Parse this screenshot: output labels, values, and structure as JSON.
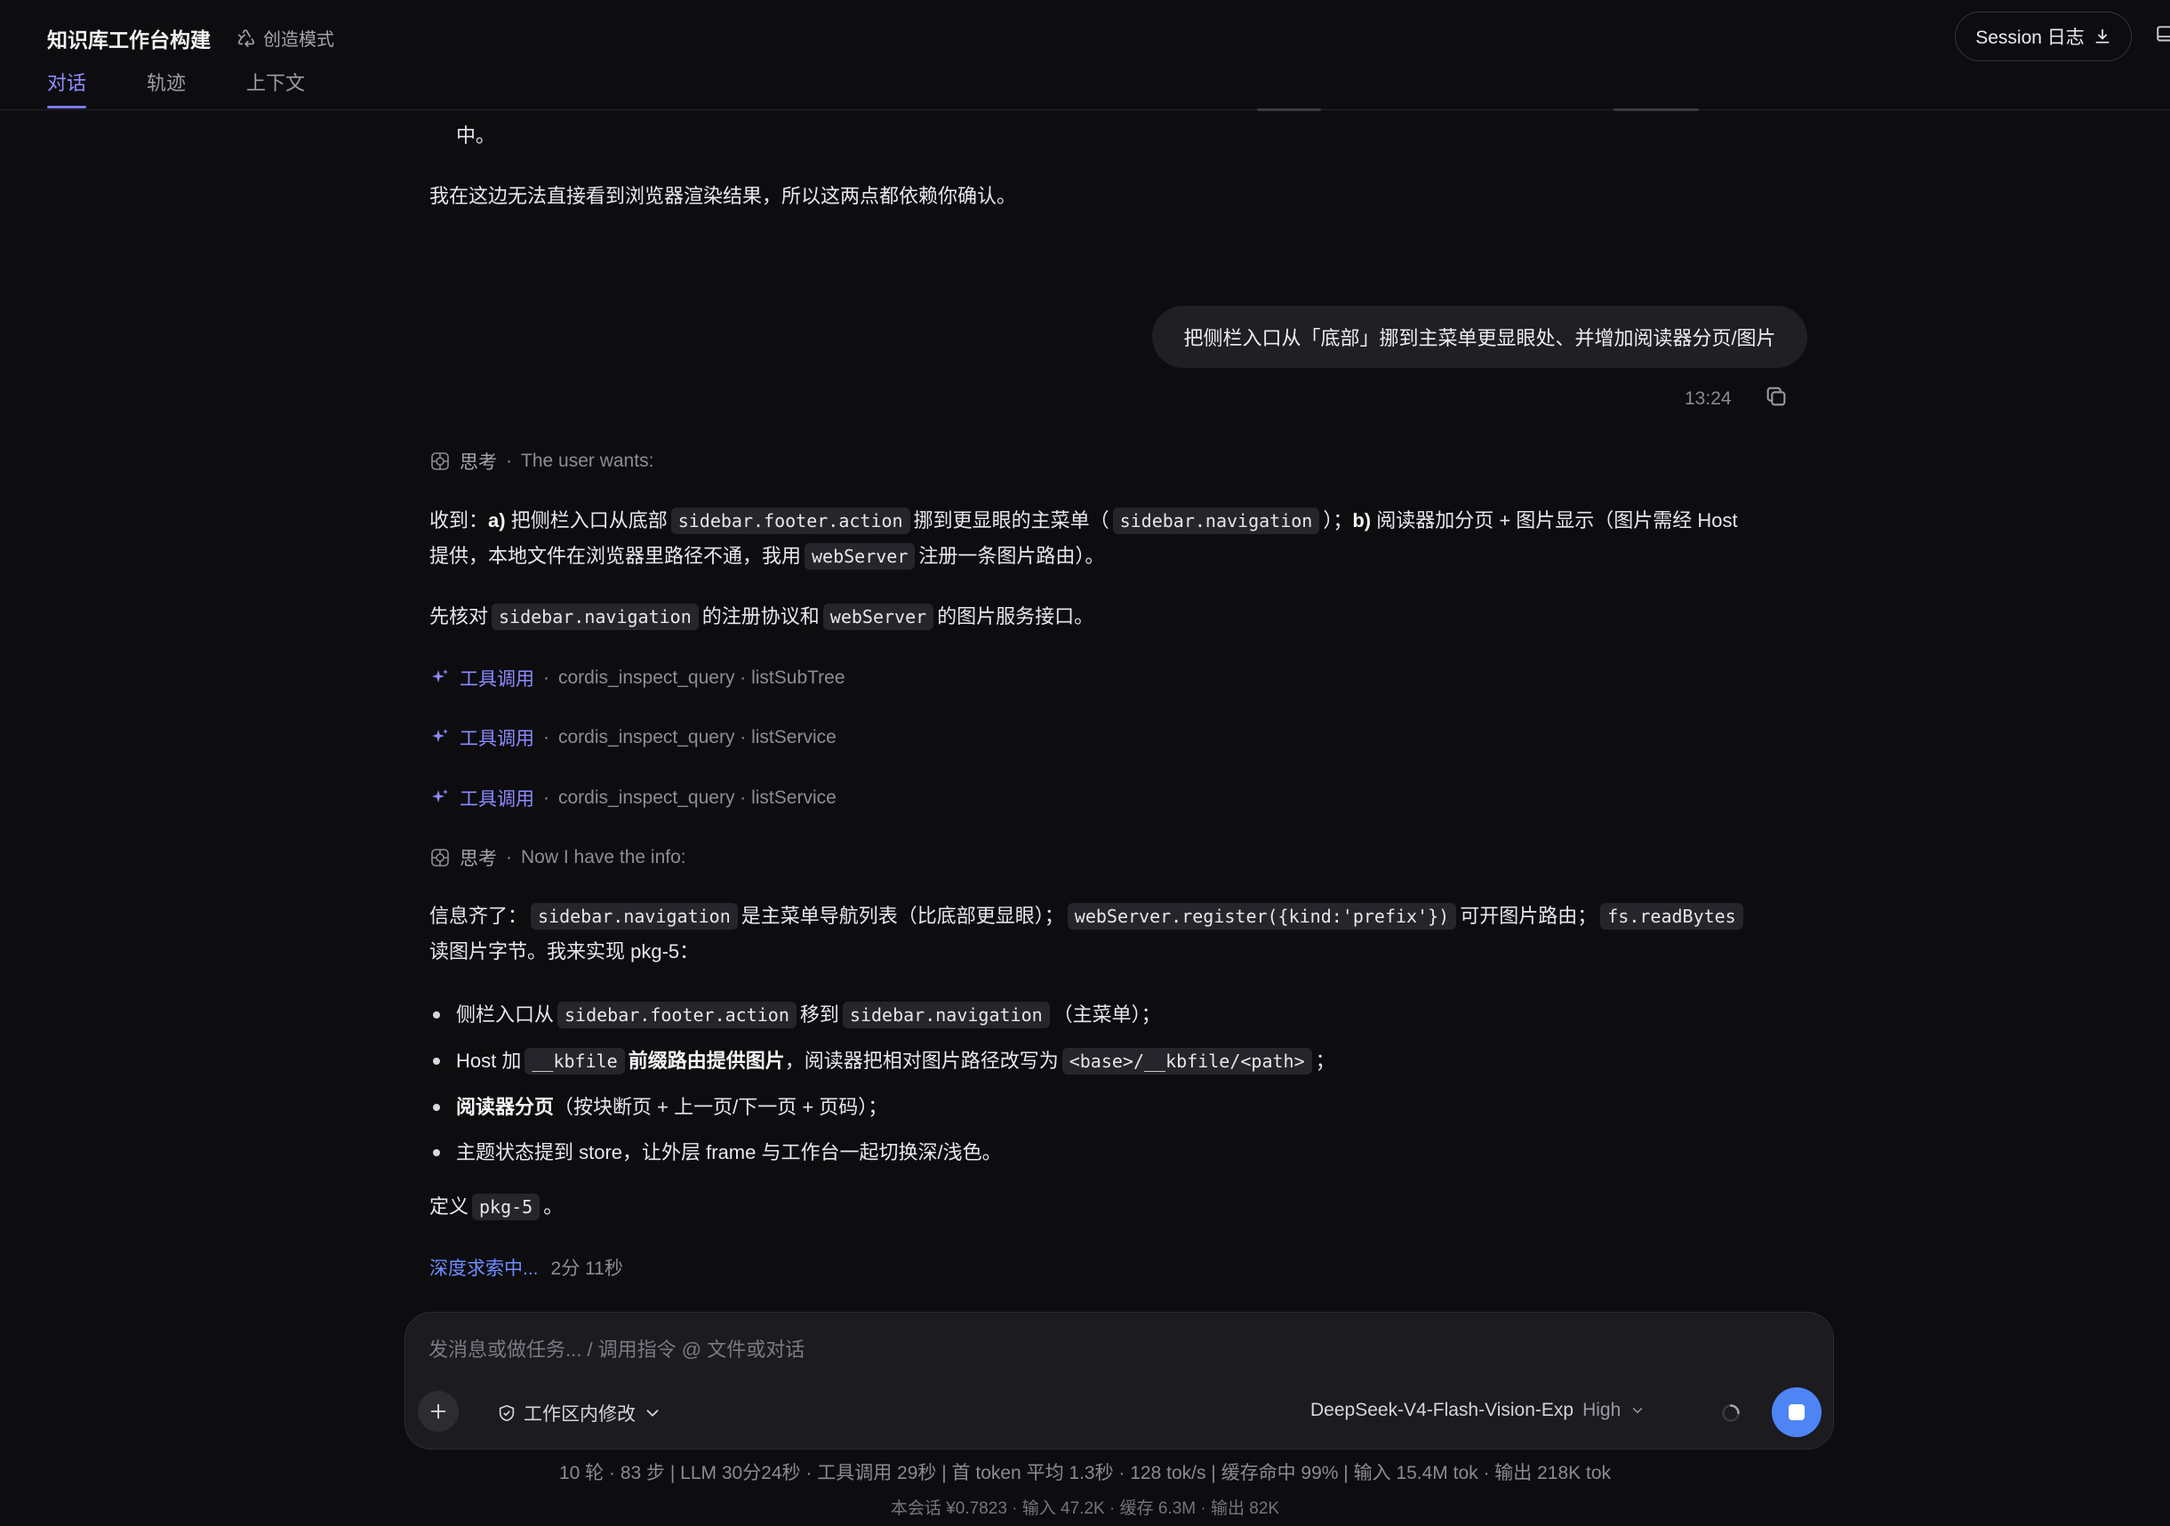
{
  "header": {
    "title": "知识库工作台构建",
    "mode": "创造模式",
    "tabs": [
      {
        "label": "对话",
        "active": true
      },
      {
        "label": "轨迹",
        "active": false
      },
      {
        "label": "上下文",
        "active": false
      }
    ],
    "session_button": "Session 日志"
  },
  "conversation": {
    "prev_tail": "中。",
    "prev_line": "我在这边无法直接看到浏览器渲染结果，所以这两点都依赖你确认。",
    "user_message": "把侧栏入口从「底部」挪到主菜单更显眼处、并增加阅读器分页/图片",
    "user_time": "13:24",
    "think1": {
      "label": "思考",
      "text": "The user wants:"
    },
    "reply1": {
      "t1": "收到：",
      "a": "a)",
      "t2": " 把侧栏入口从底部",
      "c1": "sidebar.footer.action",
      "t3": "挪到更显眼的主菜单（",
      "c2": "sidebar.navigation",
      "t4": "）；",
      "b": "b)",
      "t5": " 阅读器加分页 + 图片显示（图片需经 Host",
      "t6": "提供，本地文件在浏览器里路径不通，我用",
      "c3": "webServer",
      "t7": "注册一条图片路由）。"
    },
    "reply2": {
      "t1": "先核对",
      "c1": "sidebar.navigation",
      "t2": "的注册协议和",
      "c2": "webServer",
      "t3": "的图片服务接口。"
    },
    "tool_calls": [
      {
        "label": "工具调用",
        "detail": "cordis_inspect_query · listSubTree"
      },
      {
        "label": "工具调用",
        "detail": "cordis_inspect_query · listService"
      },
      {
        "label": "工具调用",
        "detail": "cordis_inspect_query · listService"
      }
    ],
    "think2": {
      "label": "思考",
      "text": "Now I have the info:"
    },
    "reply3": {
      "t1": "信息齐了：",
      "c1": "sidebar.navigation",
      "t2": "是主菜单导航列表（比底部更显眼）；",
      "c2": "webServer.register({kind:'prefix'})",
      "t3": "可开图片路由；",
      "c3": "fs.readBytes",
      "t4": "读图片字节。我来实现 pkg-5："
    },
    "bullets": {
      "b1": {
        "t1": "侧栏入口从",
        "c1": "sidebar.footer.action",
        "t2": "移到",
        "c2": "sidebar.navigation",
        "t3": "（主菜单）；"
      },
      "b2": {
        "t1": "Host 加",
        "c1": "__kbfile",
        "t2": "前缀路由提供图片",
        "t3": "，阅读器把相对图片路径改写为",
        "c2": "<base>/__kbfile/<path>",
        "t4": "；"
      },
      "b3": {
        "t1": "阅读器分页",
        "t2": "（按块断页 + 上一页/下一页 + 页码）；"
      },
      "b4": {
        "t1": "主题状态提到 store，让外层 frame 与工作台一起切换深/浅色。"
      }
    },
    "define": {
      "t1": "定义",
      "c1": "pkg-5",
      "t2": "。"
    },
    "searching": {
      "label": "深度求索中...",
      "elapsed": "2分 11秒"
    }
  },
  "composer": {
    "placeholder": "发消息或做任务... / 调用指令 @ 文件或对话",
    "value": "",
    "scope": "工作区内修改",
    "model": "DeepSeek-V4-Flash-Vision-Exp",
    "level": "High"
  },
  "stats": {
    "line1": "10 轮 · 83 步  |  LLM 30分24秒 · 工具调用 29秒  |  首 token 平均 1.3秒 · 128 tok/s  |  缓存命中 99%  |  输入 15.4M tok · 输出 218K tok",
    "line2": "本会话 ¥0.7823 · 输入 47.2K · 缓存 6.3M · 输出 82K"
  },
  "colors": {
    "background": "#0d0d10",
    "accent": "#8e8bff",
    "link": "#6f8cff",
    "stop_button": "#4f84f5"
  },
  "icons": [
    "recycle-icon",
    "download-icon",
    "panel-icon",
    "copy-icon",
    "brain-icon",
    "sparkle-icon",
    "plus-icon",
    "shield-icon",
    "chevron-down-icon",
    "spinner-icon",
    "stop-icon"
  ]
}
